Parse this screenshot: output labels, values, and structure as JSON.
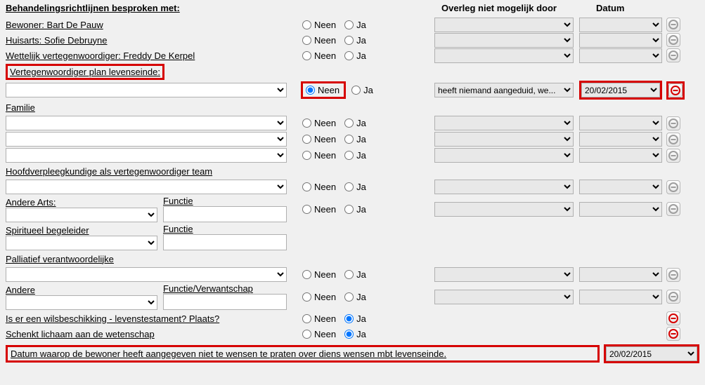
{
  "headers": {
    "left": "Behandelingsrichtlijnen besproken met:",
    "mid": "Overleg niet mogelijk door",
    "right": "Datum"
  },
  "radio": {
    "no": "Neen",
    "yes": "Ja"
  },
  "rows": {
    "bewoner": "Bewoner: Bart De Pauw",
    "huisarts": "Huisarts: Sofie Debruyne",
    "wettelijk": "Wettelijk vertegenwoordiger: Freddy De Kerpel",
    "vert_plan": "Vertegenwoordiger plan levenseinde:",
    "familie": "Familie",
    "hoofdverpleeg": "Hoofdverpleegkundige als vertegenwoordiger team",
    "andere_arts": "Andere Arts:",
    "functie": "Functie",
    "spiritueel": "Spiritueel begeleider",
    "palliatief": "Palliatief verantwoordelijke",
    "andere": "Andere",
    "functie_verw": "Functie/Verwantschap",
    "wilsbeschikking": "Is er een wilsbeschikking - levenstestament? Plaats?",
    "schenkt": "Schenkt lichaam aan de wetenschap",
    "footer": "Datum waarop de bewoner heeft aangegeven niet te wensen te praten over diens wensen mbt levenseinde."
  },
  "values": {
    "vert_reason": "heeft niemand aangeduid, we...",
    "vert_date": "20/02/2015",
    "footer_date": "20/02/2015"
  }
}
